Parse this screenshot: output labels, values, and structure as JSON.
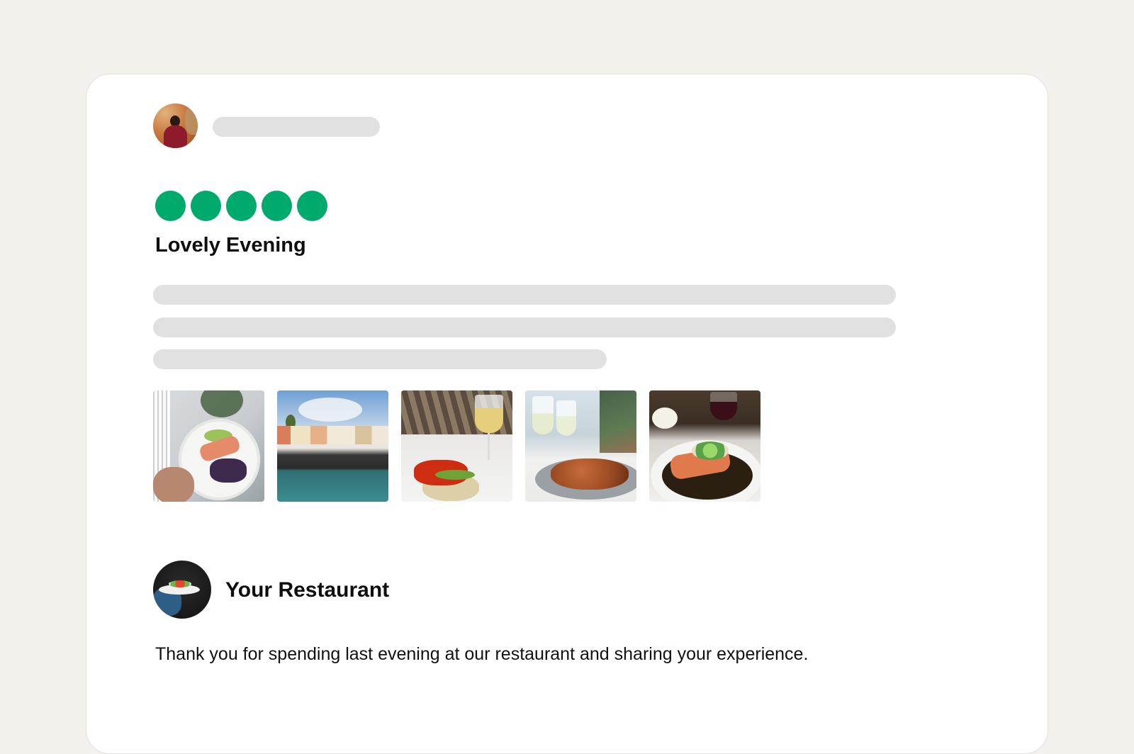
{
  "review": {
    "reviewer_avatar_icon": "reviewer-avatar",
    "rating": {
      "value": 5,
      "max": 5,
      "color": "#00aa6c"
    },
    "title": "Lovely Evening",
    "photos": [
      {
        "description": "plated salmon with purple puree held by server"
      },
      {
        "description": "seaside town with colorful buildings and sea"
      },
      {
        "description": "lobster dish with white wine glass"
      },
      {
        "description": "wine glasses and nachos plate on terrace"
      },
      {
        "description": "salmon with vegetables in bowl and red wine"
      }
    ]
  },
  "owner_response": {
    "avatar_icon": "owner-avatar",
    "name": "Your Restaurant",
    "text": "Thank you for spending last evening at our restaurant and sharing your experience."
  },
  "colors": {
    "page_background": "#f2f1ec",
    "card_background": "#ffffff",
    "placeholder": "#e1e1e1",
    "rating": "#00aa6c"
  }
}
